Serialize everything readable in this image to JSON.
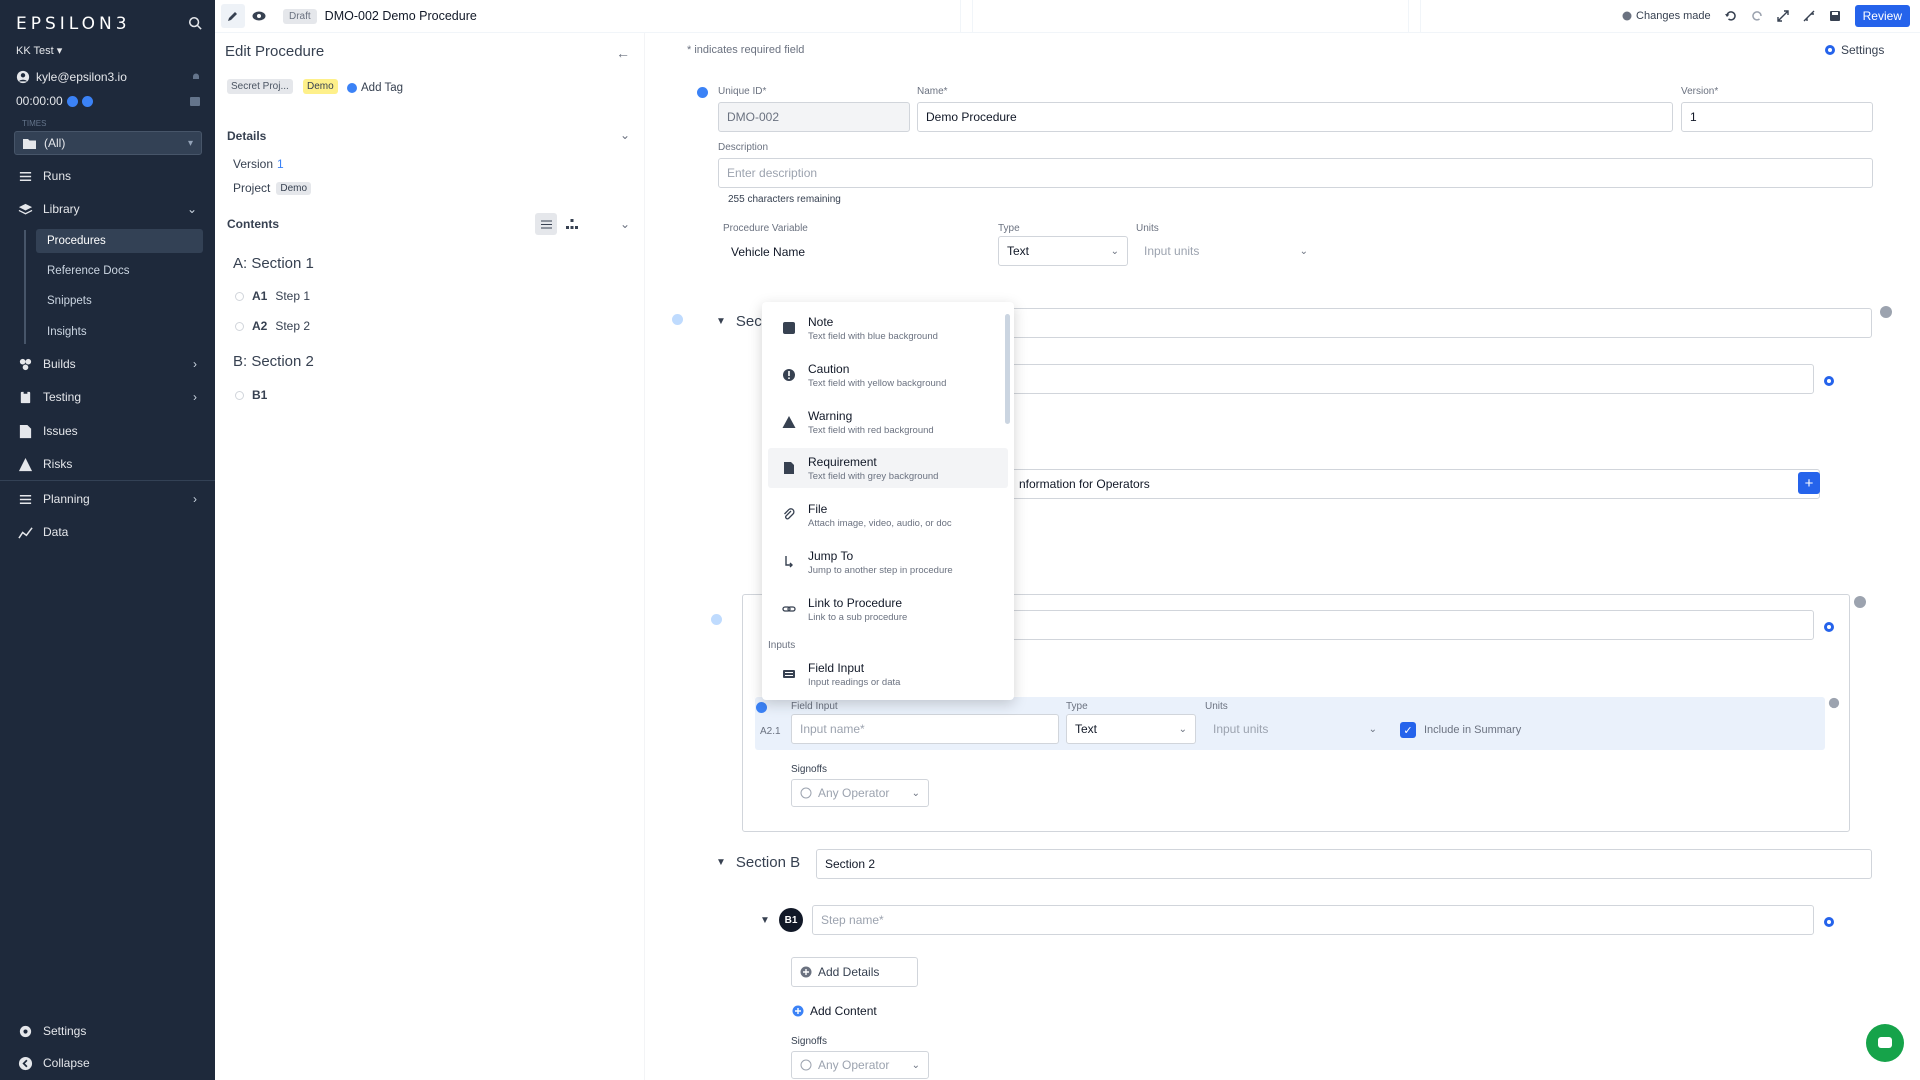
{
  "sidebar": {
    "logo": "EPSILON3",
    "org": "KK Test ▾",
    "user_email": "kyle@epsilon3.io",
    "timer": "00:00:00",
    "project_label": "TIMES",
    "project_value": "(All)",
    "nav": {
      "runs": "Runs",
      "library": "Library",
      "procedures": "Procedures",
      "reference_docs": "Reference Docs",
      "snippets": "Snippets",
      "insights": "Insights",
      "builds": "Builds",
      "testing": "Testing",
      "issues": "Issues",
      "risks": "Risks",
      "planning": "Planning",
      "data": "Data",
      "settings": "Settings",
      "collapse": "Collapse"
    }
  },
  "topbar": {
    "draft_badge": "Draft",
    "title": "DMO-002 Demo Procedure",
    "changes": "Changes made",
    "review": "Review"
  },
  "left_panel": {
    "title": "Edit Procedure",
    "tags": [
      "Secret Proj...",
      "Demo"
    ],
    "add_tag": "Add Tag",
    "details_header": "Details",
    "version_label": "Version",
    "version_value": "1",
    "project_label": "Project",
    "project_value": "Demo",
    "contents_header": "Contents",
    "section_a": "A: Section 1",
    "step_a1_id": "A1",
    "step_a1_name": "Step 1",
    "step_a2_id": "A2",
    "step_a2_name": "Step 2",
    "section_b": "B: Section 2",
    "step_b1_id": "B1"
  },
  "main": {
    "required_note": "* indicates required field",
    "settings": "Settings",
    "unique_id_label": "Unique ID*",
    "unique_id_value": "DMO-002",
    "name_label": "Name*",
    "name_value": "Demo Procedure",
    "version_label": "Version*",
    "version_value": "1",
    "description_label": "Description",
    "description_placeholder": "Enter description",
    "chars_remaining": "255 characters remaining",
    "proc_var_label": "Procedure Variable",
    "proc_var_value": "Vehicle Name",
    "type_label": "Type",
    "type_value": "Text",
    "units_label": "Units",
    "units_placeholder": "Input units",
    "section_a_partial": "Sec",
    "info_ops": "nformation for Operators",
    "field_input_label": "Field Input",
    "field_input_id": "A2.1",
    "input_name_placeholder": "Input name*",
    "fi_type_label": "Type",
    "fi_type_value": "Text",
    "fi_units_label": "Units",
    "fi_units_placeholder": "Input units",
    "include_summary": "Include in Summary",
    "signoffs_label": "Signoffs",
    "any_operator": "Any Operator",
    "section_b_label": "Section B",
    "section_b_value": "Section 2",
    "step_b1_badge": "B1",
    "step_name_placeholder": "Step name*",
    "add_details": "Add Details",
    "add_content": "Add Content",
    "signoffs_label_2": "Signoffs",
    "any_operator_2": "Any Operator"
  },
  "menu": {
    "items": [
      {
        "title": "Note",
        "sub": "Text field with blue background",
        "icon": "note-icon"
      },
      {
        "title": "Caution",
        "sub": "Text field with yellow background",
        "icon": "caution-icon"
      },
      {
        "title": "Warning",
        "sub": "Text field with red background",
        "icon": "warning-icon"
      },
      {
        "title": "Requirement",
        "sub": "Text field with grey background",
        "icon": "requirement-icon"
      },
      {
        "title": "File",
        "sub": "Attach image, video, audio, or doc",
        "icon": "paperclip-icon"
      },
      {
        "title": "Jump To",
        "sub": "Jump to another step in procedure",
        "icon": "jump-icon"
      },
      {
        "title": "Link to Procedure",
        "sub": "Link to a sub procedure",
        "icon": "link-icon"
      }
    ],
    "group_inputs": "Inputs",
    "field_input_title": "Field Input",
    "field_input_sub": "Input readings or data"
  },
  "colors": {
    "sidebar_bg": "#1e293b",
    "accent": "#2563eb",
    "tag_demo": "#fef08a"
  }
}
